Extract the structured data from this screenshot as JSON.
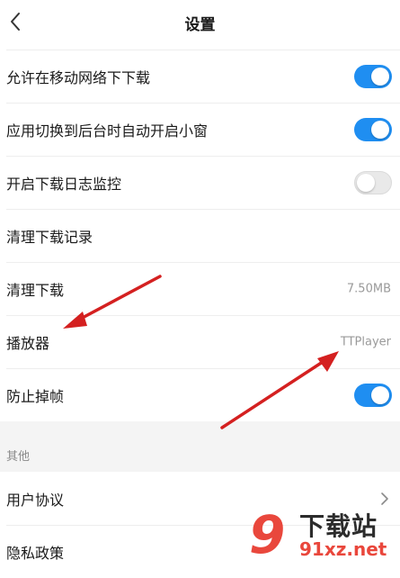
{
  "header": {
    "title": "设置"
  },
  "settings": [
    {
      "label": "允许在移动网络下下载",
      "toggle": "on"
    },
    {
      "label": "应用切换到后台时自动开启小窗",
      "toggle": "on"
    },
    {
      "label": "开启下载日志监控",
      "toggle": "off"
    },
    {
      "label": "清理下载记录"
    },
    {
      "label": "清理下载",
      "value": "7.50MB"
    },
    {
      "label": "播放器",
      "value": "TTPlayer"
    },
    {
      "label": "防止掉帧",
      "toggle": "on"
    }
  ],
  "other": {
    "section_title": "其他",
    "items": [
      {
        "label": "用户协议"
      },
      {
        "label": "隐私政策"
      }
    ]
  },
  "watermark": {
    "logo": "9",
    "brand": "下载站",
    "url": "91xz.net"
  },
  "colors": {
    "toggle_on": "#1f8ef1",
    "arrow": "#d42020",
    "watermark_red": "#e9473c"
  }
}
